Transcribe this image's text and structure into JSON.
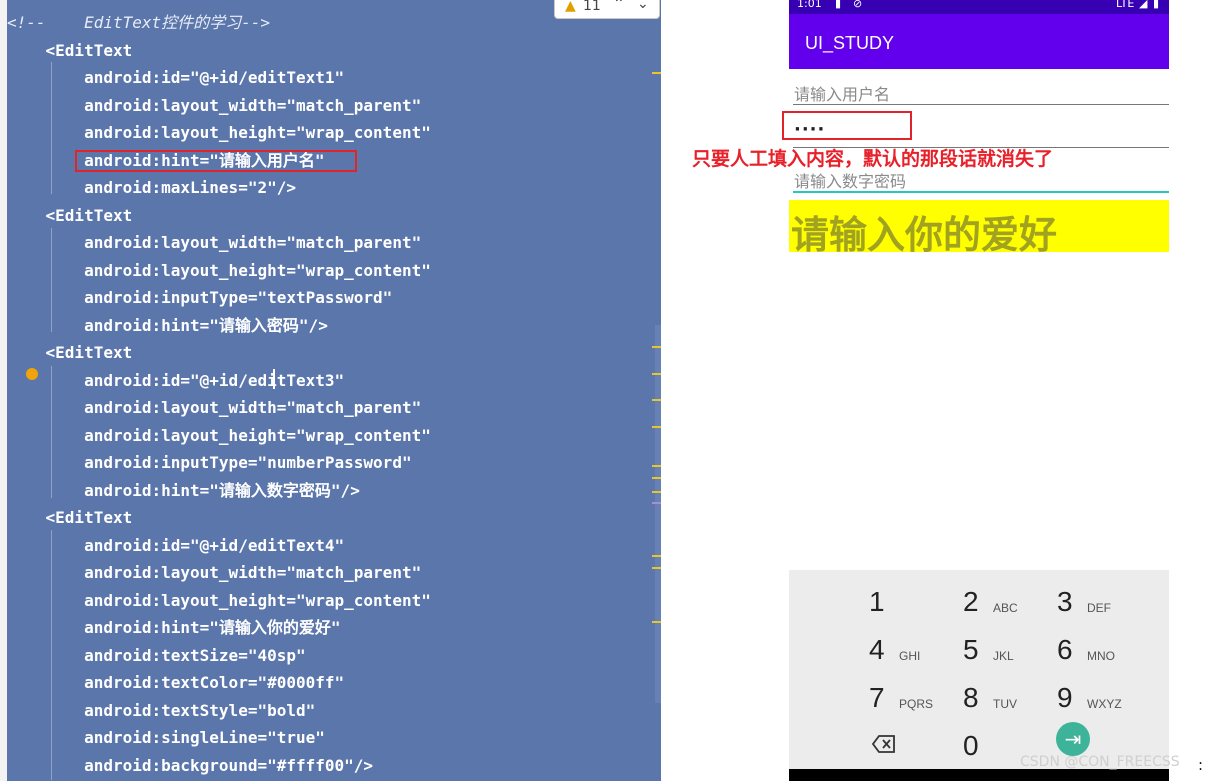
{
  "editor": {
    "lines": [
      "<!--    EditText控件的学习-->",
      "    <EditText",
      "        android:id=\"@+id/editText1\"",
      "        android:layout_width=\"match_parent\"",
      "        android:layout_height=\"wrap_content\"",
      "        android:hint=\"请输入用户名\"",
      "        android:maxLines=\"2\"/>",
      "    <EditText",
      "        android:layout_width=\"match_parent\"",
      "        android:layout_height=\"wrap_content\"",
      "        android:inputType=\"textPassword\"",
      "        android:hint=\"请输入密码\"/>",
      "    <EditText",
      "        android:id=\"@+id/editText3\"",
      "        android:layout_width=\"match_parent\"",
      "        android:layout_height=\"wrap_content\"",
      "        android:inputType=\"numberPassword\"",
      "        android:hint=\"请输入数字密码\"/>",
      "    <EditText",
      "        android:id=\"@+id/editText4\"",
      "        android:layout_width=\"match_parent\"",
      "        android:layout_height=\"wrap_content\"",
      "        android:hint=\"请输入你的爱好\"",
      "        android:textSize=\"40sp\"",
      "        android:textColor=\"#0000ff\"",
      "        android:textStyle=\"bold\"",
      "        android:singleLine=\"true\"",
      "        android:background=\"#ffff00\"/>"
    ],
    "inspection": {
      "warning_count": "11",
      "up_arrow": "⌃",
      "down_arrow": "⌄"
    }
  },
  "annotation": {
    "text": "只要人工填入内容，默认的那段话就消失了"
  },
  "phone": {
    "status": {
      "time": "1:01",
      "network": "LTE"
    },
    "app_title": "UI_STUDY",
    "username_hint": "请输入用户名",
    "password_value": "····",
    "number_password_hint": "请输入数字密码",
    "hobby_hint": "请输入你的爱好",
    "keypad": [
      {
        "num": "1",
        "letters": ""
      },
      {
        "num": "2",
        "letters": "ABC"
      },
      {
        "num": "3",
        "letters": "DEF"
      },
      {
        "num": "4",
        "letters": "GHI"
      },
      {
        "num": "5",
        "letters": "JKL"
      },
      {
        "num": "6",
        "letters": "MNO"
      },
      {
        "num": "7",
        "letters": "PQRS"
      },
      {
        "num": "8",
        "letters": "TUV"
      },
      {
        "num": "9",
        "letters": "WXYZ"
      },
      {
        "num": "0",
        "letters": ""
      }
    ]
  },
  "watermark": "CSDN @CON_FREECSS",
  "colors": {
    "editor_bg": "#5b76ab",
    "app_bar": "#6200ee",
    "status_bar": "#3700b3",
    "annotation_red": "#e8202a",
    "hobby_bg": "#ffff00",
    "focus_teal": "#26c6c6",
    "next_key": "#3db39a"
  },
  "icons": {
    "warning": "warning-icon",
    "backspace": "backspace-icon",
    "next": "next-icon"
  }
}
